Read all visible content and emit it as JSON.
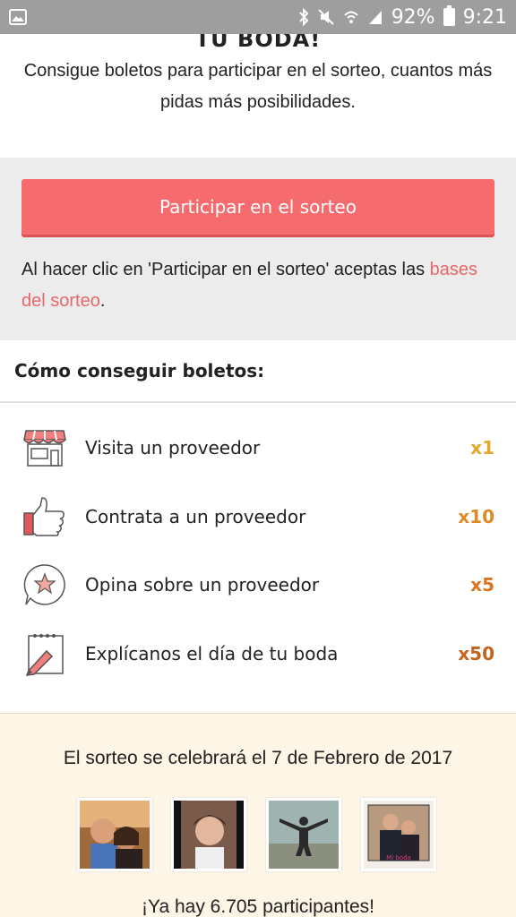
{
  "status_bar": {
    "battery": "92%",
    "time": "9:21"
  },
  "intro": {
    "title": "TU BODA!",
    "text": "Consigue boletos para participar en el sorteo, cuantos más pidas más posibilidades."
  },
  "cta": {
    "button_label": "Participar en el sorteo",
    "note_prefix": "Al hacer clic en 'Participar en el sorteo' aceptas las ",
    "note_link": "bases del sorteo",
    "note_suffix": ".",
    "accent": "#f56b6e"
  },
  "how": {
    "title": "Cómo conseguir boletos:",
    "items": [
      {
        "label": "Visita un proveedor",
        "multiplier": "x1",
        "icon": "store-icon",
        "color": "#e6a62a"
      },
      {
        "label": "Contrata a un proveedor",
        "multiplier": "x10",
        "icon": "thumbs-up-icon",
        "color": "#e08a26"
      },
      {
        "label": "Opina sobre un proveedor",
        "multiplier": "x5",
        "icon": "star-chat-icon",
        "color": "#d9741f"
      },
      {
        "label": "Explícanos el día de tu boda",
        "multiplier": "x50",
        "icon": "notepad-pencil-icon",
        "color": "#c4641c"
      }
    ]
  },
  "footer": {
    "date_text": "El sorteo se celebrará el 7 de Febrero de 2017",
    "participants": "¡Ya hay 6.705 participantes!",
    "photo_signature": "Mi boda"
  }
}
